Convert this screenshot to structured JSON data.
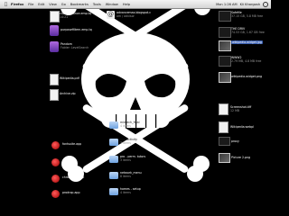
{
  "menubar": {
    "apple": "",
    "items": [
      "Firefox",
      "File",
      "Edit",
      "View",
      "Go",
      "Bookmarks",
      "Tools",
      "Window",
      "Help"
    ],
    "status": [
      "Mon 1:26 AM",
      "Kli Khargosh"
    ]
  },
  "desktop_left": [
    {
      "name": "cite / advance.emp.tq",
      "sub": "14:21",
      "kind": "file"
    },
    {
      "name": "purposefiltern.emp.tq",
      "sub": "",
      "kind": "purple"
    },
    {
      "name": "Pandom",
      "sub": "Folder: LevelSearch",
      "kind": "purple"
    },
    {
      "name": "Wikipedia.pdf",
      "sub": "",
      "kind": "file"
    },
    {
      "name": "Archive.zip",
      "sub": "",
      "kind": "file"
    },
    {
      "name": "fontsuite.app",
      "sub": "",
      "kind": "red"
    },
    {
      "name": "pro.app",
      "sub": "",
      "kind": "red"
    },
    {
      "name": "chronology.app",
      "sub": "",
      "kind": "red"
    },
    {
      "name": "prodrop.app",
      "sub": "",
      "kind": "red"
    }
  ],
  "desktop_top_mid": {
    "name": "advancemax.blogspot.c",
    "sub": "om / advisor"
  },
  "desktop_center": [
    {
      "name": "midtech_final",
      "sub": "4 items"
    },
    {
      "name": "productivity",
      "sub": "3 items"
    },
    {
      "name": "pro - perm. tutors",
      "sub": "3 items"
    },
    {
      "name": "network_menu",
      "sub": "8 items"
    },
    {
      "name": "homes - setup",
      "sub": "4 items"
    }
  ],
  "desktop_right": [
    {
      "name": "SafeMe",
      "sub": "37.15 GB, 5.8 MB free",
      "kind": "dark"
    },
    {
      "name": "THE DRIV",
      "sub": "74.53 GB, 1.67 GB free",
      "kind": "dark"
    },
    {
      "name": "wikipedia-widget.jpg",
      "sub": "",
      "kind": "photo",
      "hl": true
    },
    {
      "name": "WWW2",
      "sub": "2.79 MB, 4.8 MB free",
      "kind": "dark"
    },
    {
      "name": "wikipedia-widget.png",
      "sub": "",
      "kind": "photo"
    },
    {
      "name": "Screenshot.tiff",
      "sub": "12 MB",
      "kind": "file"
    },
    {
      "name": "Wikipedia.webpl",
      "sub": "",
      "kind": "file"
    },
    {
      "name": "proxy",
      "sub": "",
      "kind": "dark"
    },
    {
      "name": "Picture 2.png",
      "sub": "",
      "kind": "photo"
    }
  ],
  "colors": {
    "skull": "#ffffff",
    "background": "#000000",
    "highlight": "#3a5fb0"
  }
}
